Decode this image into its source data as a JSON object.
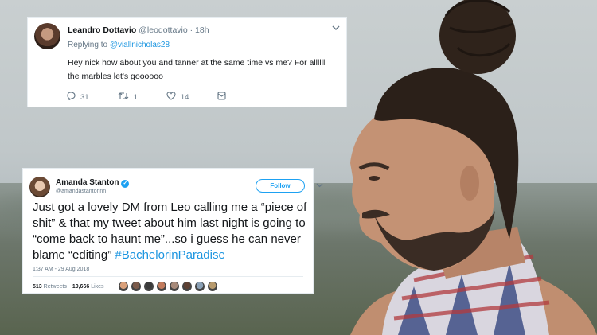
{
  "tweet1": {
    "name": "Leandro Dottavio",
    "handle": "@leodottavio",
    "time": "· 18h",
    "replying_prefix": "Replying to ",
    "replying_handle": "@viallnicholas28",
    "text": "Hey nick how about you and tanner at the same time vs me? For allllll the marbles let's goooooo",
    "replies": "31",
    "retweets": "1",
    "likes": "14",
    "icons": {
      "reply": "reply-icon",
      "retweet": "retweet-icon",
      "like": "heart-icon",
      "dm": "message-icon",
      "menu": "chevron-down-icon"
    }
  },
  "tweet2": {
    "name": "Amanda Stanton",
    "handle": "@amandastantonnn",
    "follow_label": "Follow",
    "text": "Just got a lovely DM from Leo calling me a “piece of shit” & that my tweet about him last night is going to “come back to haunt me”...so i guess he can never blame “editing” ",
    "hashtag": "#BachelorinParadise",
    "timestamp": "1:37 AM - 29 Aug 2018",
    "retweets_count": "513",
    "retweets_label": "Retweets",
    "likes_count": "10,666",
    "likes_label": "Likes",
    "liker_colors": [
      "#d9a07a",
      "#7b5a4a",
      "#3b3b3b",
      "#c27b5d",
      "#a78a7a",
      "#5d4033",
      "#8aa0b5",
      "#b79a6d"
    ],
    "icons": {
      "verified": "verified-icon",
      "menu": "chevron-down-icon"
    }
  },
  "colors": {
    "link": "#1b95e0",
    "twitter_blue": "#1da1f2",
    "text": "#14171a",
    "muted": "#657786"
  }
}
